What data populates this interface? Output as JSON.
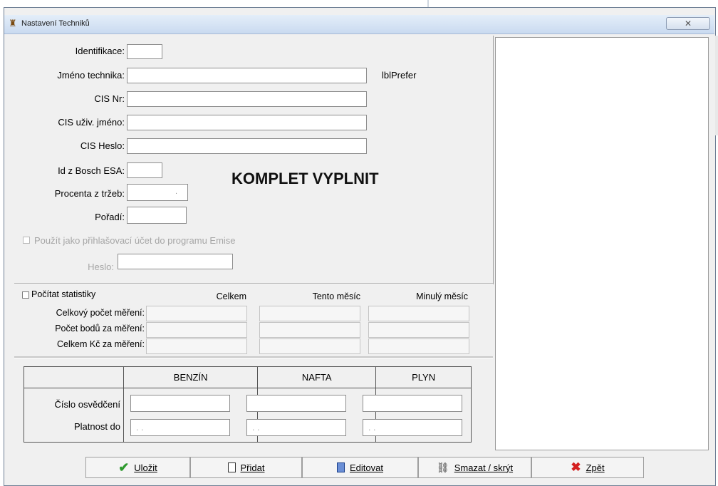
{
  "window": {
    "title": "Nastavení Techniků",
    "close_glyph": "✕"
  },
  "form": {
    "fields": [
      {
        "label": "Identifikace:",
        "value": ""
      },
      {
        "label": "Jméno technika:",
        "value": ""
      },
      {
        "label": "CIS Nr:",
        "value": ""
      },
      {
        "label": "CIS uživ. jméno:",
        "value": ""
      },
      {
        "label": "CIS Heslo:",
        "value": ""
      },
      {
        "label": "Id z Bosch ESA:",
        "value": ""
      },
      {
        "label": "Procenta z tržeb:",
        "value": "."
      },
      {
        "label": "Pořadí:",
        "value": ""
      }
    ],
    "lbl_prefer": "lblPrefer",
    "banner": "KOMPLET VYPLNIT",
    "login_checkbox_label": "Použít jako přihlašovací účet do programu Emise",
    "password_label": "Heslo:"
  },
  "stats": {
    "checkbox_label": "Počítat statistiky",
    "columns": [
      "Celkem",
      "Tento měsíc",
      "Minulý měsíc"
    ],
    "rows": [
      "Celkový počet měření:",
      "Počet bodů za měření:",
      "Celkem Kč za měření:"
    ]
  },
  "certs": {
    "columns": [
      "BENZÍN",
      "NAFTA",
      "PLYN"
    ],
    "rows": [
      "Číslo osvědčení",
      "Platnost do"
    ],
    "date_placeholder": ". ."
  },
  "buttons": {
    "save": {
      "label": "Uložit",
      "icon": "check-icon"
    },
    "add": {
      "label": "Přidat",
      "icon": "new-document-icon"
    },
    "edit": {
      "label": "Editovat",
      "icon": "edit-document-icon"
    },
    "delete": {
      "label": "Smazat / skrýt",
      "icon": "trash-icon"
    },
    "back": {
      "label": "Zpět",
      "icon": "red-x-icon"
    }
  },
  "colors": {
    "save_check": "#2e9a2e",
    "back_x": "#d42020"
  }
}
